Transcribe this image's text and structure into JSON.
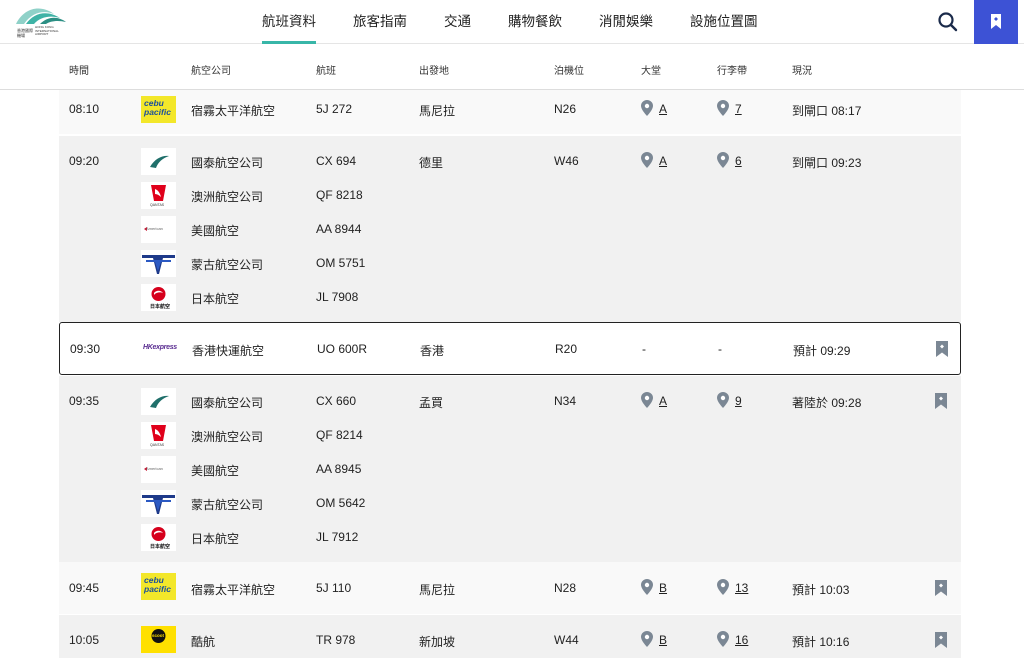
{
  "site": {
    "logo_text_zh": "香港國際機場",
    "logo_text_en": "HONG KONG INTERNATIONAL AIRPORT"
  },
  "nav": {
    "items": [
      {
        "label": "航班資料",
        "active": true
      },
      {
        "label": "旅客指南",
        "active": false
      },
      {
        "label": "交通",
        "active": false
      },
      {
        "label": "購物餐飲",
        "active": false
      },
      {
        "label": "消閒娛樂",
        "active": false
      },
      {
        "label": "設施位置圖",
        "active": false
      }
    ],
    "search_icon": "search-icon",
    "bookmark_icon": "bookmark-icon",
    "bookmark_color": "#3d52d5",
    "accent": "#38b6a8"
  },
  "columns": {
    "time": "時間",
    "airline": "航空公司",
    "flight": "航班",
    "origin": "出發地",
    "stand": "泊機位",
    "hall": "大堂",
    "belt": "行李帶",
    "status": "現況"
  },
  "rows": [
    {
      "time": "08:10",
      "origin": "馬尼拉",
      "stand": "N26",
      "hall": "A",
      "belt": "7",
      "status": "到閘口 08:17",
      "flights": [
        {
          "airline": "宿霧太平洋航空",
          "flight": "5J 272",
          "logo": "cebu-pacific"
        }
      ]
    },
    {
      "time": "09:20",
      "origin": "德里",
      "stand": "W46",
      "hall": "A",
      "belt": "6",
      "status": "到閘口 09:23",
      "flights": [
        {
          "airline": "國泰航空公司",
          "flight": "CX 694",
          "logo": "cathay"
        },
        {
          "airline": "澳洲航空公司",
          "flight": "QF 8218",
          "logo": "qantas"
        },
        {
          "airline": "美國航空",
          "flight": "AA 8944",
          "logo": "american"
        },
        {
          "airline": "蒙古航空公司",
          "flight": "OM 5751",
          "logo": "miat"
        },
        {
          "airline": "日本航空",
          "flight": "JL 7908",
          "logo": "jal"
        }
      ]
    },
    {
      "time": "09:30",
      "origin": "香港",
      "stand": "R20",
      "hall": "-",
      "belt": "-",
      "status": "預計 09:29",
      "flights": [
        {
          "airline": "香港快運航空",
          "flight": "UO 600R",
          "logo": "hk-express"
        }
      ]
    },
    {
      "time": "09:35",
      "origin": "孟買",
      "stand": "N34",
      "hall": "A",
      "belt": "9",
      "status": "著陸於 09:28",
      "flights": [
        {
          "airline": "國泰航空公司",
          "flight": "CX 660",
          "logo": "cathay"
        },
        {
          "airline": "澳洲航空公司",
          "flight": "QF 8214",
          "logo": "qantas"
        },
        {
          "airline": "美國航空",
          "flight": "AA 8945",
          "logo": "american"
        },
        {
          "airline": "蒙古航空公司",
          "flight": "OM 5642",
          "logo": "miat"
        },
        {
          "airline": "日本航空",
          "flight": "JL 7912",
          "logo": "jal"
        }
      ]
    },
    {
      "time": "09:45",
      "origin": "馬尼拉",
      "stand": "N28",
      "hall": "B",
      "belt": "13",
      "status": "預計 10:03",
      "flights": [
        {
          "airline": "宿霧太平洋航空",
          "flight": "5J 110",
          "logo": "cebu-pacific"
        }
      ]
    },
    {
      "time": "10:05",
      "origin": "新加坡",
      "stand": "W44",
      "hall": "B",
      "belt": "16",
      "status": "預計 10:16",
      "flights": [
        {
          "airline": "酷航",
          "flight": "TR 978",
          "logo": "scoot"
        }
      ]
    }
  ],
  "logo_text": {
    "cebu": "cebu pacific",
    "hkx": "HKexpress",
    "american": "American",
    "qantas": "QANTAS",
    "jal": "日本航空",
    "scoot": "scoot"
  }
}
